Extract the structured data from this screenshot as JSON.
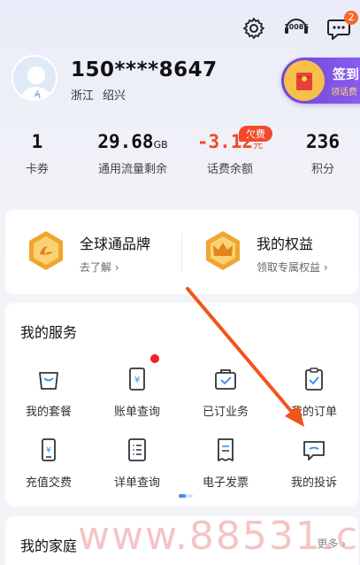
{
  "header": {
    "phone": "150****8647",
    "location": [
      "浙江",
      "绍兴"
    ],
    "icons": [
      "settings-icon",
      "hotline-10086-icon",
      "message-icon"
    ],
    "hotline_text": "10086",
    "message_badge": "2",
    "signin": {
      "title": "签到",
      "subtitle": "领话费"
    }
  },
  "stats": [
    {
      "value": "1",
      "unit": "",
      "label": "卡券"
    },
    {
      "value": "29.68",
      "unit": "GB",
      "label": "通用流量剩余"
    },
    {
      "value": "-3.12",
      "unit": "元",
      "label": "话费余额",
      "tag": "欠费"
    },
    {
      "value": "236",
      "unit": "",
      "label": "积分"
    }
  ],
  "perks": [
    {
      "title": "全球通品牌",
      "subtitle": "去了解",
      "icon": "global-brand-icon"
    },
    {
      "title": "我的权益",
      "subtitle": "领取专属权益",
      "icon": "crown-icon"
    }
  ],
  "services": {
    "title": "我的服务",
    "items": [
      {
        "label": "我的套餐",
        "icon": "bag-icon"
      },
      {
        "label": "账单查询",
        "icon": "bill-icon"
      },
      {
        "label": "已订业务",
        "icon": "subscribed-icon"
      },
      {
        "label": "我的订单",
        "icon": "order-icon"
      },
      {
        "label": "充值交费",
        "icon": "recharge-icon"
      },
      {
        "label": "详单查询",
        "icon": "detail-list-icon"
      },
      {
        "label": "电子发票",
        "icon": "invoice-icon"
      },
      {
        "label": "我的投诉",
        "icon": "complaint-icon"
      }
    ]
  },
  "family": {
    "title": "我的家庭",
    "more": "更多"
  },
  "watermark": "www.88531.cn",
  "colors": {
    "accent_red": "#f04a2a",
    "arrow": "#f2541c",
    "signin_purple": "#7a52e6"
  }
}
